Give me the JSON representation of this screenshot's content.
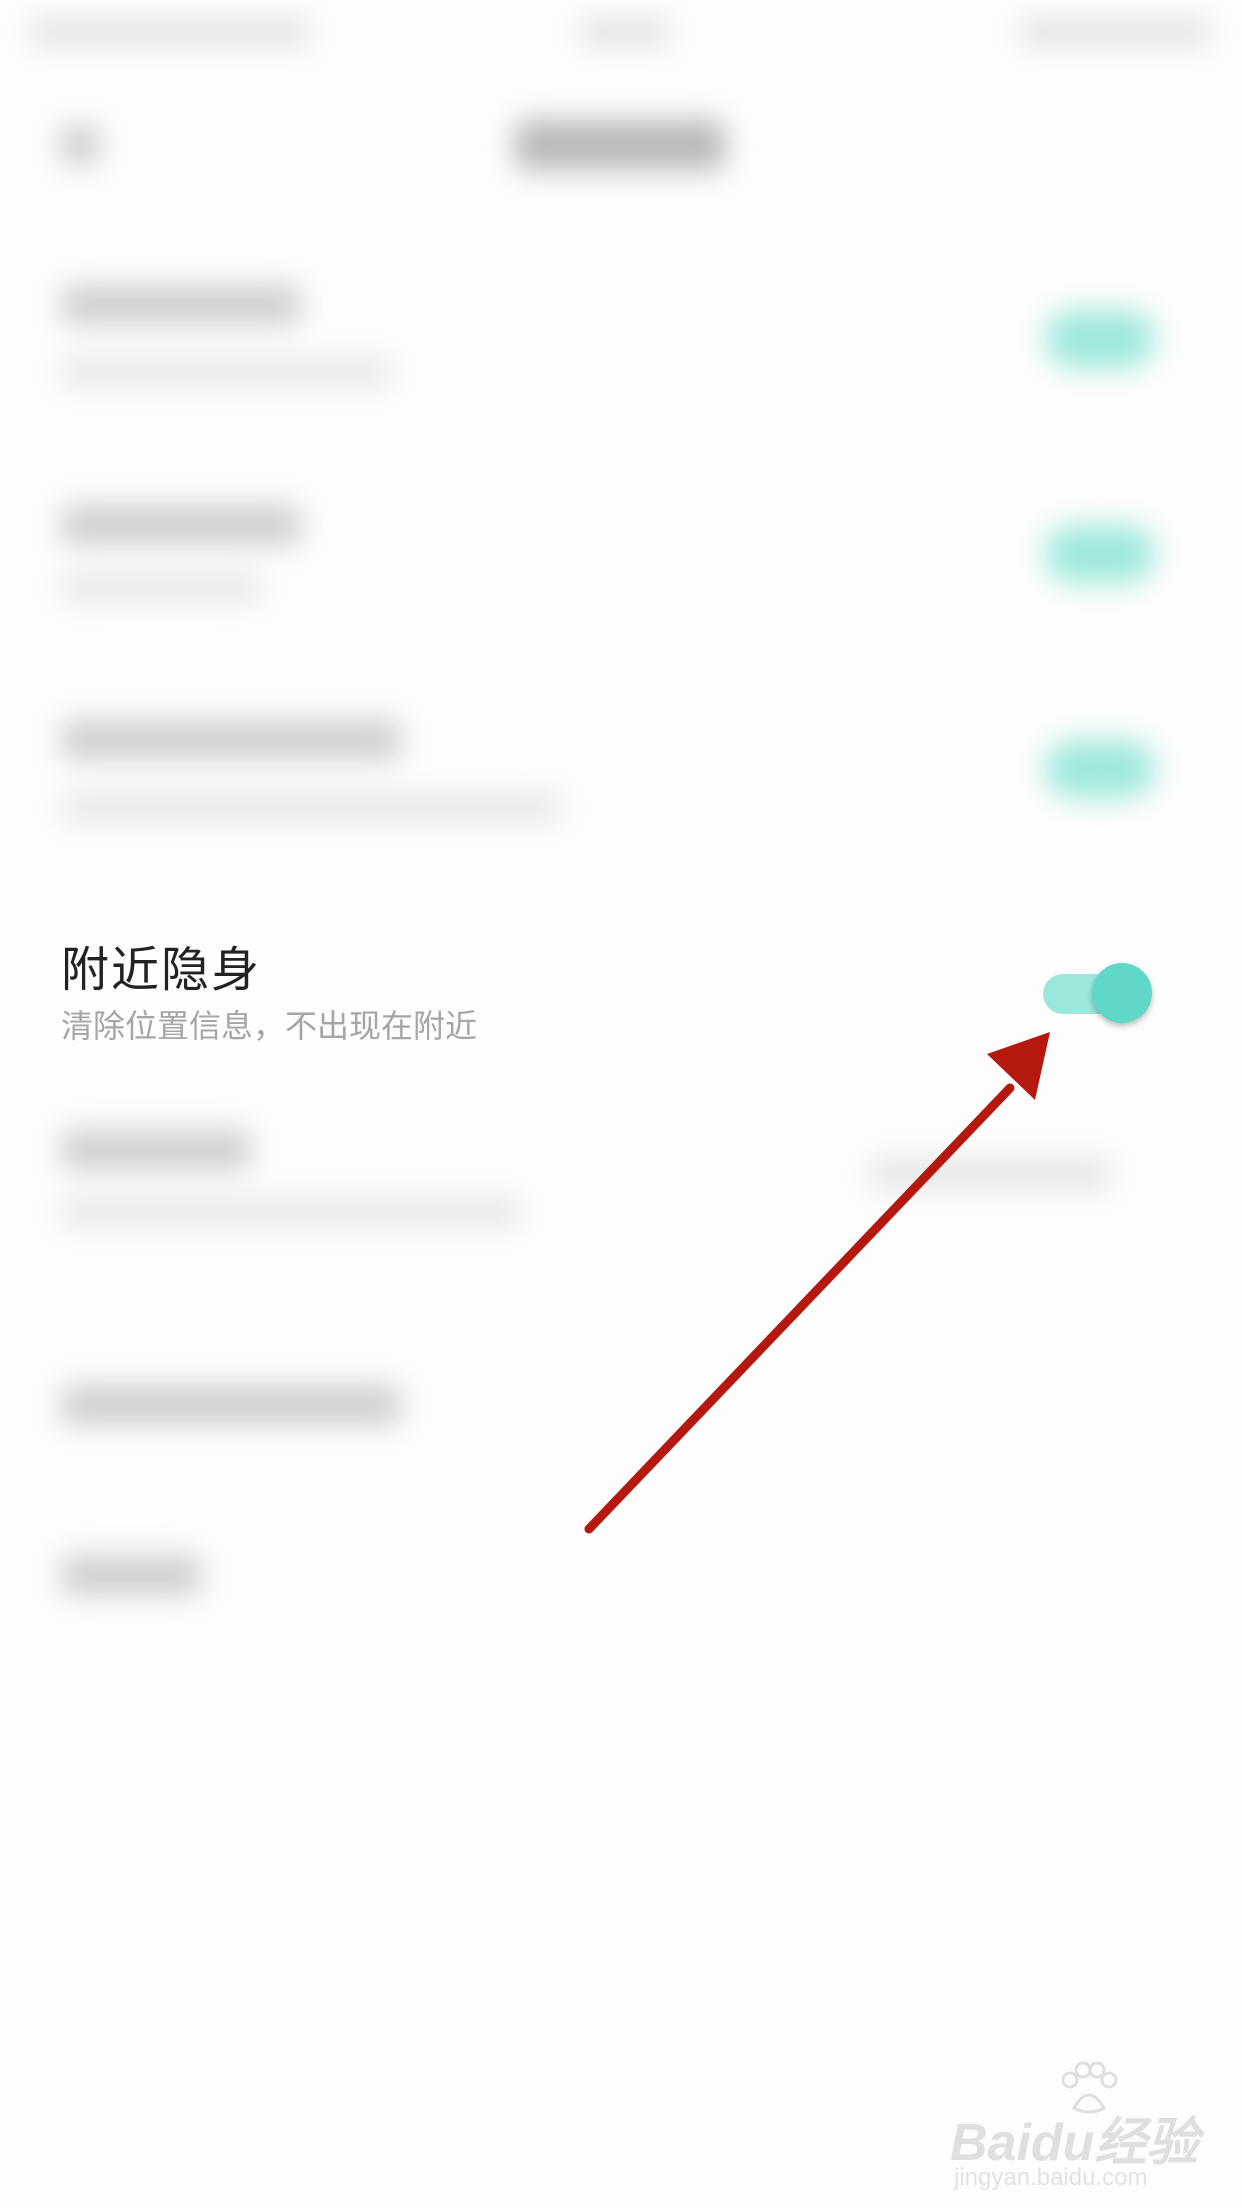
{
  "setting": {
    "title": "附近隐身",
    "subtitle": "清除位置信息，不出现在附近",
    "toggle_on": true
  },
  "watermark": {
    "logo": "Baidu经验",
    "url": "jingyan.baidu.com"
  },
  "colors": {
    "toggle_track": "#9be7dc",
    "toggle_knob": "#5fd8c7",
    "arrow": "#b5180f",
    "title_text": "#222222",
    "subtitle_text": "#a5a5a5"
  }
}
